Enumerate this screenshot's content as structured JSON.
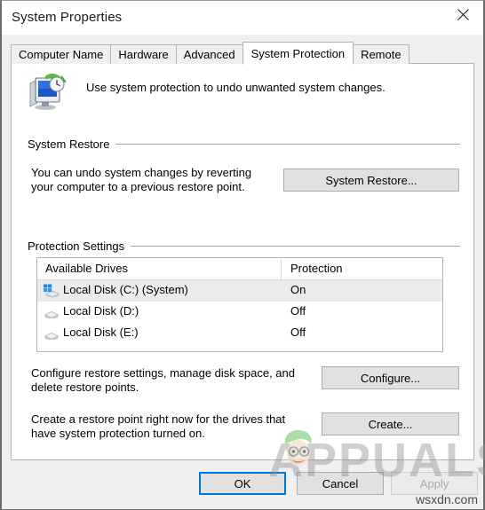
{
  "window": {
    "title": "System Properties",
    "close_icon": "close-icon"
  },
  "tabs": [
    {
      "label": "Computer Name",
      "active": false
    },
    {
      "label": "Hardware",
      "active": false
    },
    {
      "label": "Advanced",
      "active": false
    },
    {
      "label": "System Protection",
      "active": true
    },
    {
      "label": "Remote",
      "active": false
    }
  ],
  "header": {
    "icon": "system-protection-icon",
    "caption": "Use system protection to undo unwanted system changes."
  },
  "system_restore": {
    "group_label": "System Restore",
    "description": "You can undo system changes by reverting your computer to a previous restore point.",
    "button_label": "System Restore..."
  },
  "protection_settings": {
    "group_label": "Protection Settings",
    "table": {
      "columns": [
        "Available Drives",
        "Protection"
      ],
      "rows": [
        {
          "name": "Local Disk (C:) (System)",
          "protection": "On",
          "selected": true,
          "icon": "system-drive-icon"
        },
        {
          "name": "Local Disk (D:)",
          "protection": "Off",
          "selected": false,
          "icon": "drive-icon"
        },
        {
          "name": "Local Disk (E:)",
          "protection": "Off",
          "selected": false,
          "icon": "drive-icon"
        }
      ]
    },
    "configure": {
      "description": "Configure restore settings, manage disk space, and delete restore points.",
      "button_label": "Configure..."
    },
    "create": {
      "description": "Create a restore point right now for the drives that have system protection turned on.",
      "button_label": "Create..."
    }
  },
  "footer": {
    "ok_label": "OK",
    "cancel_label": "Cancel",
    "apply_label": "Apply",
    "apply_enabled": false
  },
  "watermark": {
    "text": "APPUALS",
    "site": "wsxdn.com"
  },
  "colors": {
    "accent": "#0078d7",
    "dialog_bg": "#f0f0f0",
    "panel_bg": "#ffffff",
    "button_bg": "#e1e1e1",
    "selected_row": "#ebebeb"
  }
}
